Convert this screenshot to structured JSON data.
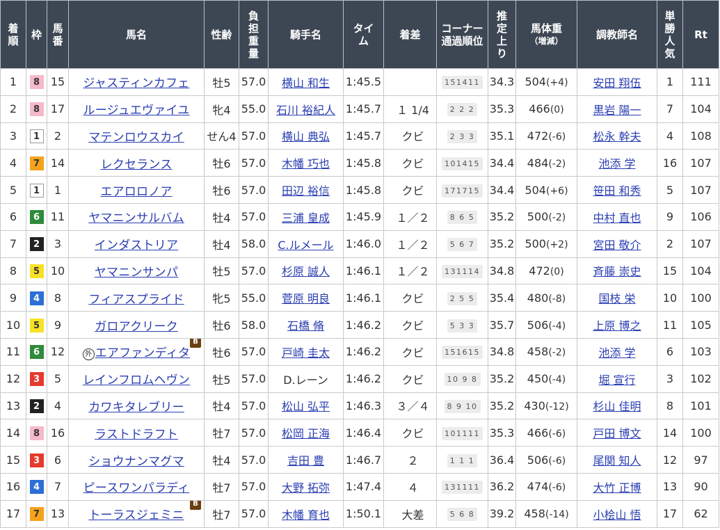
{
  "headers": {
    "finish": "着順",
    "frame": "枠",
    "number": "馬番",
    "horse": "馬名",
    "sex_age": "性齢",
    "weight": "負担重量",
    "jockey": "騎手名",
    "time": "タイム",
    "margin": "着差",
    "corner": "コーナー通過順位",
    "last3f": "推定上り",
    "body_weight": "馬体重",
    "body_weight_sub": "（増減）",
    "trainer": "調教師名",
    "popularity": "単勝人気",
    "rating": "Rt"
  },
  "frame_colors": {
    "1": {
      "bg": "#ffffff",
      "fg": "#333333",
      "border": "#999999"
    },
    "2": {
      "bg": "#222222",
      "fg": "#ffffff",
      "border": "#222222"
    },
    "3": {
      "bg": "#e63a2e",
      "fg": "#ffffff",
      "border": "#e63a2e"
    },
    "4": {
      "bg": "#2d6fd6",
      "fg": "#ffffff",
      "border": "#2d6fd6"
    },
    "5": {
      "bg": "#f7e126",
      "fg": "#333333",
      "border": "#f7e126"
    },
    "6": {
      "bg": "#2e8b3a",
      "fg": "#ffffff",
      "border": "#2e8b3a"
    },
    "7": {
      "bg": "#f5a21c",
      "fg": "#333333",
      "border": "#f5a21c"
    },
    "8": {
      "bg": "#f6b9c9",
      "fg": "#333333",
      "border": "#f6b9c9"
    }
  },
  "rows": [
    {
      "finish": "1",
      "frame": "8",
      "number": "15",
      "horse": "ジャスティンカフェ",
      "foreign": false,
      "blinker": false,
      "sex_age": "牡5",
      "weight": "57.0",
      "jockey": "横山 和生",
      "jockey_link": true,
      "time": "1:45.5",
      "margin": "",
      "corner": "151411",
      "last3f": "34.3",
      "body_weight": "504",
      "diff": "(+4)",
      "trainer": "安田 翔伍",
      "popularity": "1",
      "rating": "111"
    },
    {
      "finish": "2",
      "frame": "8",
      "number": "17",
      "horse": "ルージュエヴァイユ",
      "foreign": false,
      "blinker": false,
      "sex_age": "牝4",
      "weight": "55.0",
      "jockey": "石川 裕紀人",
      "jockey_link": true,
      "time": "1:45.7",
      "margin": "１ 1/4",
      "corner": "2 2 2",
      "last3f": "35.3",
      "body_weight": "466",
      "diff": "(0)",
      "trainer": "黒岩 陽一",
      "popularity": "7",
      "rating": "104"
    },
    {
      "finish": "3",
      "frame": "1",
      "number": "2",
      "horse": "マテンロウスカイ",
      "foreign": false,
      "blinker": false,
      "sex_age": "せん4",
      "weight": "57.0",
      "jockey": "横山 典弘",
      "jockey_link": true,
      "time": "1:45.7",
      "margin": "クビ",
      "corner": "2 3 3",
      "last3f": "35.1",
      "body_weight": "472",
      "diff": "(-6)",
      "trainer": "松永 幹夫",
      "popularity": "4",
      "rating": "108"
    },
    {
      "finish": "4",
      "frame": "7",
      "number": "14",
      "horse": "レクセランス",
      "foreign": false,
      "blinker": false,
      "sex_age": "牡6",
      "weight": "57.0",
      "jockey": "木幡 巧也",
      "jockey_link": true,
      "time": "1:45.8",
      "margin": "クビ",
      "corner": "101415",
      "last3f": "34.4",
      "body_weight": "484",
      "diff": "(-2)",
      "trainer": "池添 学",
      "popularity": "16",
      "rating": "107"
    },
    {
      "finish": "5",
      "frame": "1",
      "number": "1",
      "horse": "エアロロノア",
      "foreign": false,
      "blinker": false,
      "sex_age": "牡6",
      "weight": "57.0",
      "jockey": "田辺 裕信",
      "jockey_link": true,
      "time": "1:45.8",
      "margin": "クビ",
      "corner": "171715",
      "last3f": "34.4",
      "body_weight": "504",
      "diff": "(+6)",
      "trainer": "笹田 和秀",
      "popularity": "5",
      "rating": "107"
    },
    {
      "finish": "6",
      "frame": "6",
      "number": "11",
      "horse": "ヤマニンサルバム",
      "foreign": false,
      "blinker": false,
      "sex_age": "牡4",
      "weight": "57.0",
      "jockey": "三浦 皇成",
      "jockey_link": true,
      "time": "1:45.9",
      "margin": "１／２",
      "corner": "8 6 5",
      "last3f": "35.2",
      "body_weight": "500",
      "diff": "(-2)",
      "trainer": "中村 直也",
      "popularity": "9",
      "rating": "106"
    },
    {
      "finish": "7",
      "frame": "2",
      "number": "3",
      "horse": "インダストリア",
      "foreign": false,
      "blinker": false,
      "sex_age": "牡4",
      "weight": "58.0",
      "jockey": "C.ルメール",
      "jockey_link": true,
      "time": "1:46.0",
      "margin": "１／２",
      "corner": "5 6 7",
      "last3f": "35.2",
      "body_weight": "500",
      "diff": "(+2)",
      "trainer": "宮田 敬介",
      "popularity": "2",
      "rating": "107"
    },
    {
      "finish": "8",
      "frame": "5",
      "number": "10",
      "horse": "ヤマニンサンパ",
      "foreign": false,
      "blinker": false,
      "sex_age": "牡5",
      "weight": "57.0",
      "jockey": "杉原 誠人",
      "jockey_link": true,
      "time": "1:46.1",
      "margin": "１／２",
      "corner": "131114",
      "last3f": "34.8",
      "body_weight": "472",
      "diff": "(0)",
      "trainer": "斉藤 崇史",
      "popularity": "15",
      "rating": "104"
    },
    {
      "finish": "9",
      "frame": "4",
      "number": "8",
      "horse": "フィアスプライド",
      "foreign": false,
      "blinker": false,
      "sex_age": "牝5",
      "weight": "55.0",
      "jockey": "菅原 明良",
      "jockey_link": true,
      "time": "1:46.1",
      "margin": "クビ",
      "corner": "2 5 5",
      "last3f": "35.4",
      "body_weight": "480",
      "diff": "(-8)",
      "trainer": "国枝 栄",
      "popularity": "10",
      "rating": "100"
    },
    {
      "finish": "10",
      "frame": "5",
      "number": "9",
      "horse": "ガロアクリーク",
      "foreign": false,
      "blinker": false,
      "sex_age": "牡6",
      "weight": "58.0",
      "jockey": "石橋 脩",
      "jockey_link": true,
      "time": "1:46.2",
      "margin": "クビ",
      "corner": "5 3 3",
      "last3f": "35.7",
      "body_weight": "506",
      "diff": "(-4)",
      "trainer": "上原 博之",
      "popularity": "11",
      "rating": "105"
    },
    {
      "finish": "11",
      "frame": "6",
      "number": "12",
      "horse": "エアファンディタ",
      "foreign": true,
      "foreign_mark": "外",
      "blinker": true,
      "sex_age": "牡6",
      "weight": "57.0",
      "jockey": "戸崎 圭太",
      "jockey_link": true,
      "time": "1:46.2",
      "margin": "クビ",
      "corner": "151615",
      "last3f": "34.8",
      "body_weight": "458",
      "diff": "(-2)",
      "trainer": "池添 学",
      "popularity": "6",
      "rating": "103"
    },
    {
      "finish": "12",
      "frame": "3",
      "number": "5",
      "horse": "レインフロムヘヴン",
      "foreign": false,
      "blinker": false,
      "sex_age": "牡5",
      "weight": "57.0",
      "jockey": "D.レーン",
      "jockey_link": false,
      "time": "1:46.2",
      "margin": "クビ",
      "corner": "10 9 8",
      "last3f": "35.2",
      "body_weight": "450",
      "diff": "(-4)",
      "trainer": "堀 宣行",
      "popularity": "3",
      "rating": "102"
    },
    {
      "finish": "13",
      "frame": "2",
      "number": "4",
      "horse": "カワキタレブリー",
      "foreign": false,
      "blinker": false,
      "sex_age": "牡4",
      "weight": "57.0",
      "jockey": "松山 弘平",
      "jockey_link": true,
      "time": "1:46.3",
      "margin": "３／４",
      "corner": "8 9 10",
      "last3f": "35.2",
      "body_weight": "430",
      "diff": "(-12)",
      "trainer": "杉山 佳明",
      "popularity": "8",
      "rating": "101"
    },
    {
      "finish": "14",
      "frame": "8",
      "number": "16",
      "horse": "ラストドラフト",
      "foreign": false,
      "blinker": false,
      "sex_age": "牡7",
      "weight": "57.0",
      "jockey": "松岡 正海",
      "jockey_link": true,
      "time": "1:46.4",
      "margin": "クビ",
      "corner": "101111",
      "last3f": "35.3",
      "body_weight": "466",
      "diff": "(-6)",
      "trainer": "戸田 博文",
      "popularity": "14",
      "rating": "100"
    },
    {
      "finish": "15",
      "frame": "3",
      "number": "6",
      "horse": "ショウナンマグマ",
      "foreign": false,
      "blinker": false,
      "sex_age": "牡4",
      "weight": "57.0",
      "jockey": "吉田 豊",
      "jockey_link": true,
      "time": "1:46.7",
      "margin": "２",
      "corner": "1 1 1",
      "last3f": "36.4",
      "body_weight": "506",
      "diff": "(-6)",
      "trainer": "尾関 知人",
      "popularity": "12",
      "rating": "97"
    },
    {
      "finish": "16",
      "frame": "4",
      "number": "7",
      "horse": "ピースワンパラディ",
      "foreign": false,
      "blinker": false,
      "sex_age": "牡7",
      "weight": "57.0",
      "jockey": "大野 拓弥",
      "jockey_link": true,
      "time": "1:47.4",
      "margin": "４",
      "corner": "131111",
      "last3f": "36.2",
      "body_weight": "474",
      "diff": "(-6)",
      "trainer": "大竹 正博",
      "popularity": "13",
      "rating": "90"
    },
    {
      "finish": "17",
      "frame": "7",
      "number": "13",
      "horse": "トーラスジェミニ",
      "foreign": false,
      "blinker": true,
      "sex_age": "牡7",
      "weight": "57.0",
      "jockey": "木幡 育也",
      "jockey_link": true,
      "time": "1:50.1",
      "margin": "大差",
      "corner": "5 6 8",
      "last3f": "39.2",
      "body_weight": "458",
      "diff": "(-14)",
      "trainer": "小桧山 悟",
      "popularity": "17",
      "rating": "62"
    }
  ],
  "blinker_mark": "B"
}
